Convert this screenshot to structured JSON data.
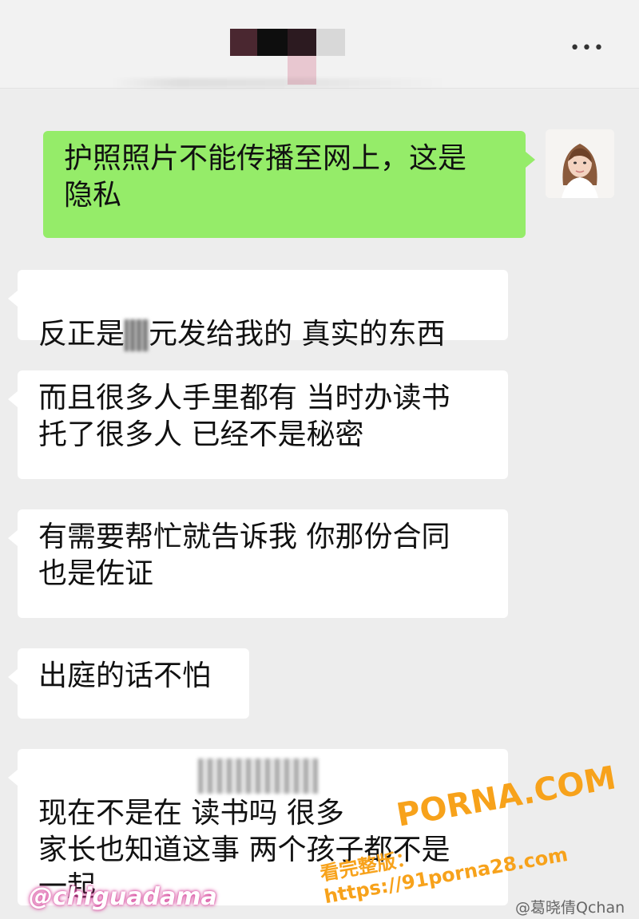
{
  "header": {
    "more_label": "•••"
  },
  "messages": [
    {
      "side": "out",
      "text": "护照照片不能传播至网上，这是\n隐私"
    },
    {
      "side": "in",
      "text_before": "反正是",
      "text_after": "元发给我的 真实的东西"
    },
    {
      "side": "in",
      "text": "而且很多人手里都有 当时办读书\n托了很多人 已经不是秘密"
    },
    {
      "side": "in",
      "text": "有需要帮忙就告诉我 你那份合同\n也是佐证"
    },
    {
      "side": "in",
      "text": "出庭的话不怕"
    },
    {
      "side": "in",
      "text": "现在不是在            读书吗 很多\n家长也知道这事 两个孩子都不是\n一起"
    }
  ],
  "watermarks": {
    "site": "PORNA.COM",
    "url": "看完整版：https://91porna28.com",
    "handle": "@chiguadama",
    "weibo": "@葛晓倩Qchan"
  }
}
